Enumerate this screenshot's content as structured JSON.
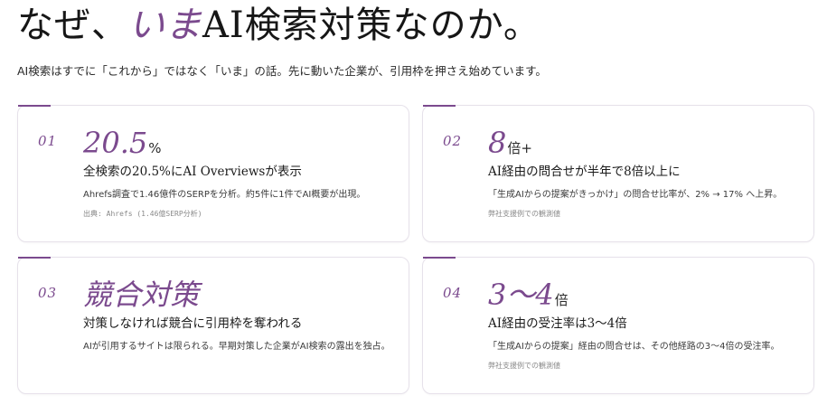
{
  "header": {
    "title_prefix": "なぜ、",
    "title_accent": "いま",
    "title_suffix": "AI検索対策なのか。",
    "lead": "AI検索はすでに「これから」ではなく「いま」の話。先に動いた企業が、引用枠を押さえ始めています。"
  },
  "theme": {
    "accent_color": "#7b4a8e",
    "text_color": "#1a1a1a",
    "border_color": "#e6e1ea"
  },
  "cards": [
    {
      "number": "01",
      "stat_value": "20.5",
      "stat_unit": "%",
      "title": "全検索の20.5%にAI Overviewsが表示",
      "description": "Ahrefs調査で1.46億件のSERPを分析。約5件に1件でAI概要が出現。",
      "source": "出典: Ahrefs (1.46億SERP分析)"
    },
    {
      "number": "02",
      "stat_value": "8",
      "stat_unit": "倍+",
      "title": "AI経由の問合せが半年で8倍以上に",
      "description": "「生成AIからの提案がきっかけ」の問合せ比率が、2% → 17% へ上昇。",
      "source": "弊社支援例での観測値"
    },
    {
      "number": "03",
      "stat_value": "競合対策",
      "stat_unit": "",
      "title": "対策しなければ競合に引用枠を奪われる",
      "description": "AIが引用するサイトは限られる。早期対策した企業がAI検索の露出を独占。",
      "source": ""
    },
    {
      "number": "04",
      "stat_value": "3〜4",
      "stat_unit": "倍",
      "title": "AI経由の受注率は3〜4倍",
      "description": "「生成AIからの提案」経由の問合せは、その他経路の3〜4倍の受注率。",
      "source": "弊社支援例での観測値"
    }
  ]
}
